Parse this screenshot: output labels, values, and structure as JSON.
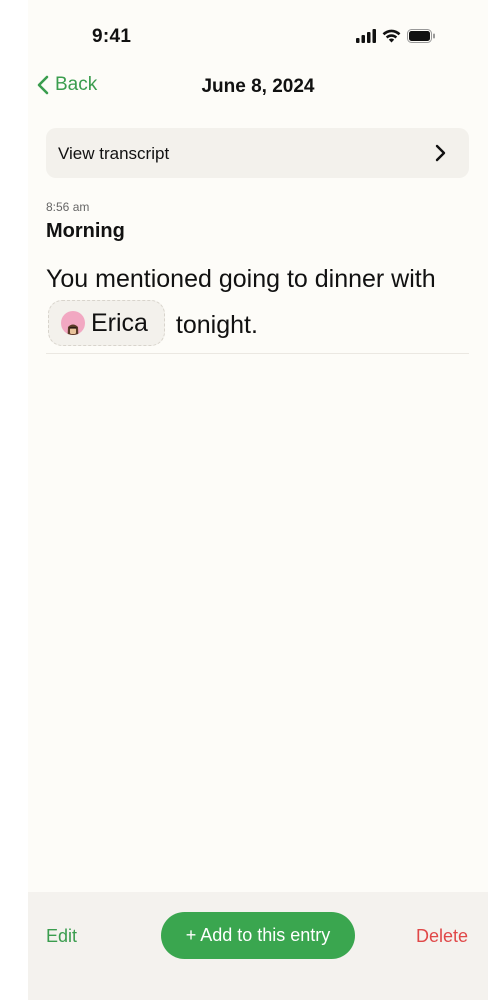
{
  "status_bar": {
    "time": "9:41",
    "icons": [
      "signal-icon",
      "wifi-icon",
      "battery-icon"
    ]
  },
  "nav": {
    "back_label": "Back",
    "title": "June 8, 2024"
  },
  "transcript": {
    "label": "View transcript"
  },
  "entry": {
    "time": "8:56 am",
    "title": "Morning",
    "text_before": "You mentioned going to dinner with",
    "mention": "Erica",
    "text_after": "tonight."
  },
  "bottom_bar": {
    "edit_label": "Edit",
    "add_label": "+ Add to this entry",
    "delete_label": "Delete"
  },
  "colors": {
    "accent": "#3aa64f",
    "destructive": "#e04848",
    "background": "#fdfcf8"
  }
}
